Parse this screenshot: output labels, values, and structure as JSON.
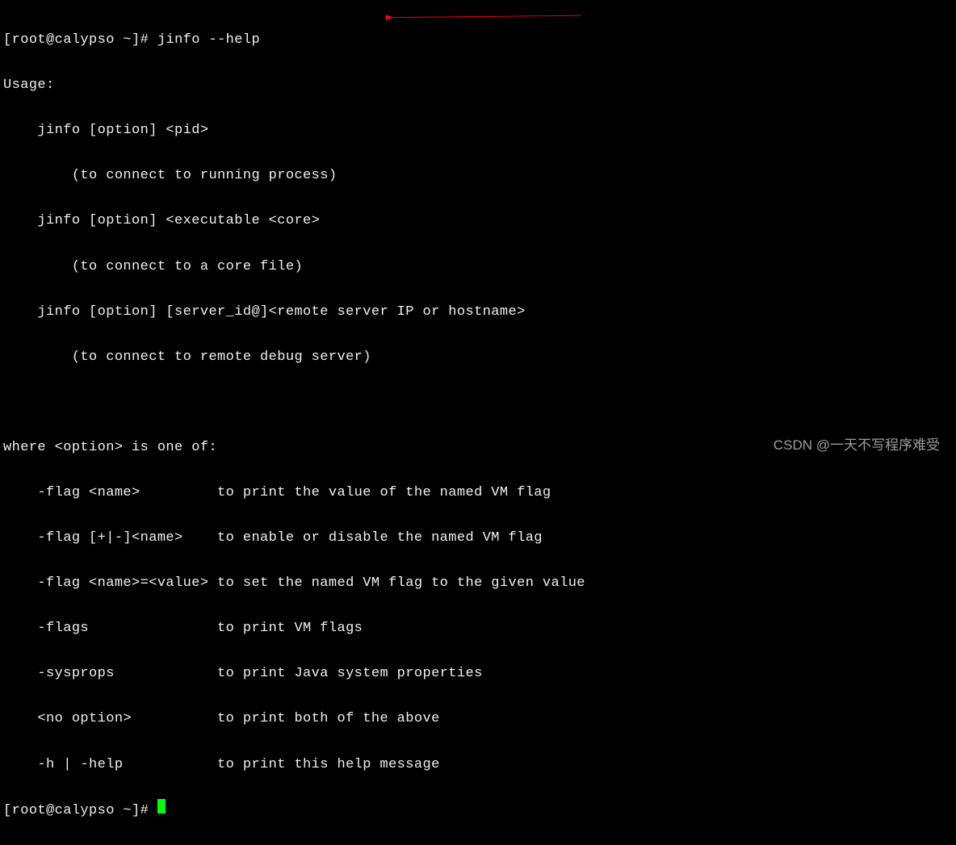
{
  "prompt1": {
    "bracket_open": "[",
    "user_host": "root@calypso ~",
    "bracket_close": "]# ",
    "command": "jinfo --help"
  },
  "usage_header": "Usage:",
  "usage_lines": [
    "    jinfo [option] <pid>",
    "        (to connect to running process)",
    "    jinfo [option] <executable <core>",
    "        (to connect to a core file)",
    "    jinfo [option] [server_id@]<remote server IP or hostname>",
    "        (to connect to remote debug server)"
  ],
  "where_header": "where <option> is one of:",
  "options": [
    "    -flag <name>         to print the value of the named VM flag",
    "    -flag [+|-]<name>    to enable or disable the named VM flag",
    "    -flag <name>=<value> to set the named VM flag to the given value",
    "    -flags               to print VM flags",
    "    -sysprops            to print Java system properties",
    "    <no option>          to print both of the above",
    "    -h | -help           to print this help message"
  ],
  "prompt2": {
    "bracket_open": "[",
    "user_host": "root@calypso ~",
    "bracket_close": "]# "
  },
  "watermark": "CSDN @一天不写程序难受"
}
